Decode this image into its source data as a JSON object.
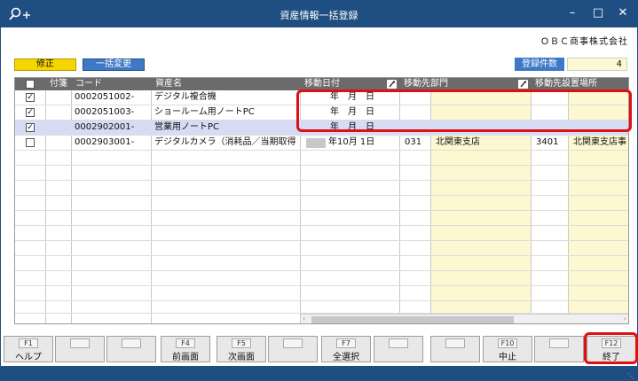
{
  "window": {
    "title": "資産情報一括登録",
    "company": "ＯＢＣ商事株式会社"
  },
  "toolbar": {
    "modify_label": "修正",
    "bulk_change_label": "一括変更"
  },
  "count": {
    "label": "登録件数",
    "value": "4"
  },
  "columns": [
    "",
    "付箋",
    "コード",
    "資産名",
    "移動日付",
    "移動先部門",
    "移動先設置場所"
  ],
  "rows": [
    {
      "checked": "✓",
      "code": "0002051002-",
      "name": "デジタル複合機",
      "date": "年　月　日",
      "dept_code": "",
      "dept_name": "",
      "loc_code": "",
      "loc_name": ""
    },
    {
      "checked": "✓",
      "code": "0002051003-",
      "name": "ショールーム用ノートPC",
      "date": "年　月　日",
      "dept_code": "",
      "dept_name": "",
      "loc_code": "",
      "loc_name": ""
    },
    {
      "checked": "✓",
      "code": "0002902001-",
      "name": "営業用ノートPC",
      "date": "年　月　日",
      "dept_code": "",
      "dept_name": "",
      "loc_code": "",
      "loc_name": ""
    },
    {
      "checked": "",
      "code": "0002903001-",
      "name": "デジタルカメラ（消耗品／当期取得",
      "date": "年10月 1日",
      "dept_code": "031",
      "dept_name": "北関東支店",
      "loc_code": "3401",
      "loc_name": "北関東支店事"
    }
  ],
  "fkeys": [
    {
      "key": "F1",
      "label": "ヘルプ"
    },
    {
      "key": "",
      "label": ""
    },
    {
      "key": "",
      "label": ""
    },
    {
      "key": "F4",
      "label": "前画面"
    },
    {
      "key": "F5",
      "label": "次画面"
    },
    {
      "key": "",
      "label": ""
    },
    {
      "key": "F7",
      "label": "全選択"
    },
    {
      "key": "",
      "label": ""
    },
    {
      "key": "",
      "label": ""
    },
    {
      "key": "F10",
      "label": "中止"
    },
    {
      "key": "",
      "label": ""
    },
    {
      "key": "F12",
      "label": "終了"
    }
  ]
}
